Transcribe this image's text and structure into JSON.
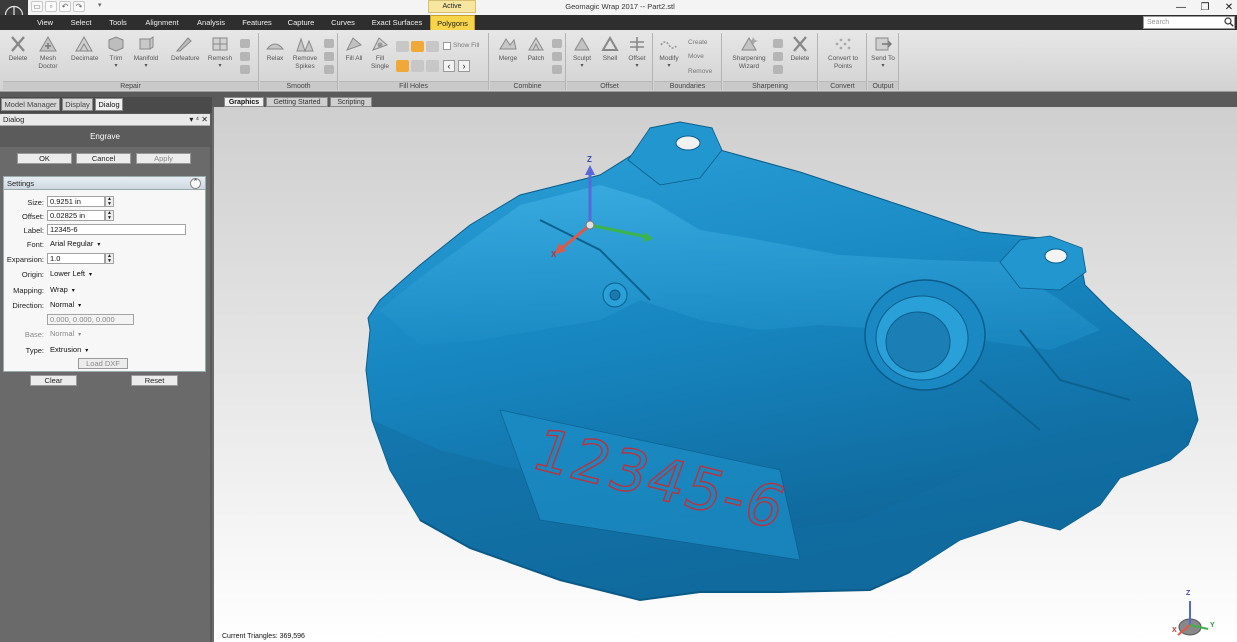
{
  "titlebar": {
    "active_tag": "Active",
    "window_title": "Geomagic Wrap 2017 -- Part2.stl",
    "minimize": "—",
    "maximize": "❐",
    "close": "✕"
  },
  "menu": {
    "items": [
      "View",
      "Select",
      "Tools",
      "Alignment",
      "Analysis",
      "Features",
      "Capture",
      "Curves",
      "Exact Surfaces",
      "Polygons"
    ],
    "search_placeholder": "Search"
  },
  "ribbon": {
    "repair": {
      "label": "Repair",
      "buttons": [
        "Delete",
        "Mesh Doctor",
        "Decimate",
        "Trim",
        "Manifold",
        "Defeature",
        "Remesh"
      ]
    },
    "smooth": {
      "label": "Smooth",
      "buttons": [
        "Relax",
        "Remove Spikes"
      ]
    },
    "fill_holes": {
      "label": "Fill Holes",
      "buttons": [
        "Fill All",
        "Fill Single"
      ],
      "show_fill": "Show Fill"
    },
    "combine": {
      "label": "Combine",
      "buttons": [
        "Merge",
        "Patch"
      ]
    },
    "offset": {
      "label": "Offset",
      "buttons": [
        "Sculpt",
        "Shell",
        "Offset"
      ]
    },
    "boundaries": {
      "label": "Boundaries",
      "buttons": [
        "Modify"
      ],
      "create": "Create",
      "move": "Move",
      "remove": "Remove"
    },
    "sharpening": {
      "label": "Sharpening",
      "buttons": [
        "Sharpening Wizard",
        "Delete"
      ]
    },
    "convert": {
      "label": "Convert",
      "buttons": [
        "Convert to Points"
      ]
    },
    "output": {
      "label": "Output",
      "buttons": [
        "Send To"
      ]
    }
  },
  "left_panel": {
    "tabs": [
      "Model Manager",
      "Display",
      "Dialog"
    ],
    "header": "Dialog",
    "header_controls": "▾ ⁴ ✕",
    "dialog_title": "Engrave",
    "ok": "OK",
    "cancel": "Cancel",
    "apply": "Apply",
    "settings": {
      "title": "Settings",
      "collapse": "⌃",
      "size_label": "Size:",
      "size_value": "0.9251 in",
      "offset_label": "Offset:",
      "offset_value": "0.02825 in",
      "label_label": "Label:",
      "label_value": "12345-6",
      "font_label": "Font:",
      "font_value": "Arial Regular",
      "expansion_label": "Expansion:",
      "expansion_value": "1.0",
      "origin_label": "Origin:",
      "origin_value": "Lower Left",
      "mapping_label": "Mapping:",
      "mapping_value": "Wrap",
      "direction_label": "Direction:",
      "direction_value": "Normal",
      "direction_vector": "0.000, 0.000, 0.000",
      "base_label": "Base:",
      "base_value": "Normal",
      "type_label": "Type:",
      "type_value": "Extrusion",
      "load_dxf": "Load DXF"
    },
    "clear": "Clear",
    "reset": "Reset"
  },
  "viewport": {
    "tabs": [
      "Graphics",
      "Getting Started",
      "Scripting"
    ],
    "engraved_text": "12345-6",
    "axis_z": "Z",
    "axis_x": "X",
    "axis_y": "Y",
    "status": "Current Triangles: 369,596",
    "colors": {
      "mesh": "#1a8ac4",
      "engrave": "#c0303a"
    }
  }
}
